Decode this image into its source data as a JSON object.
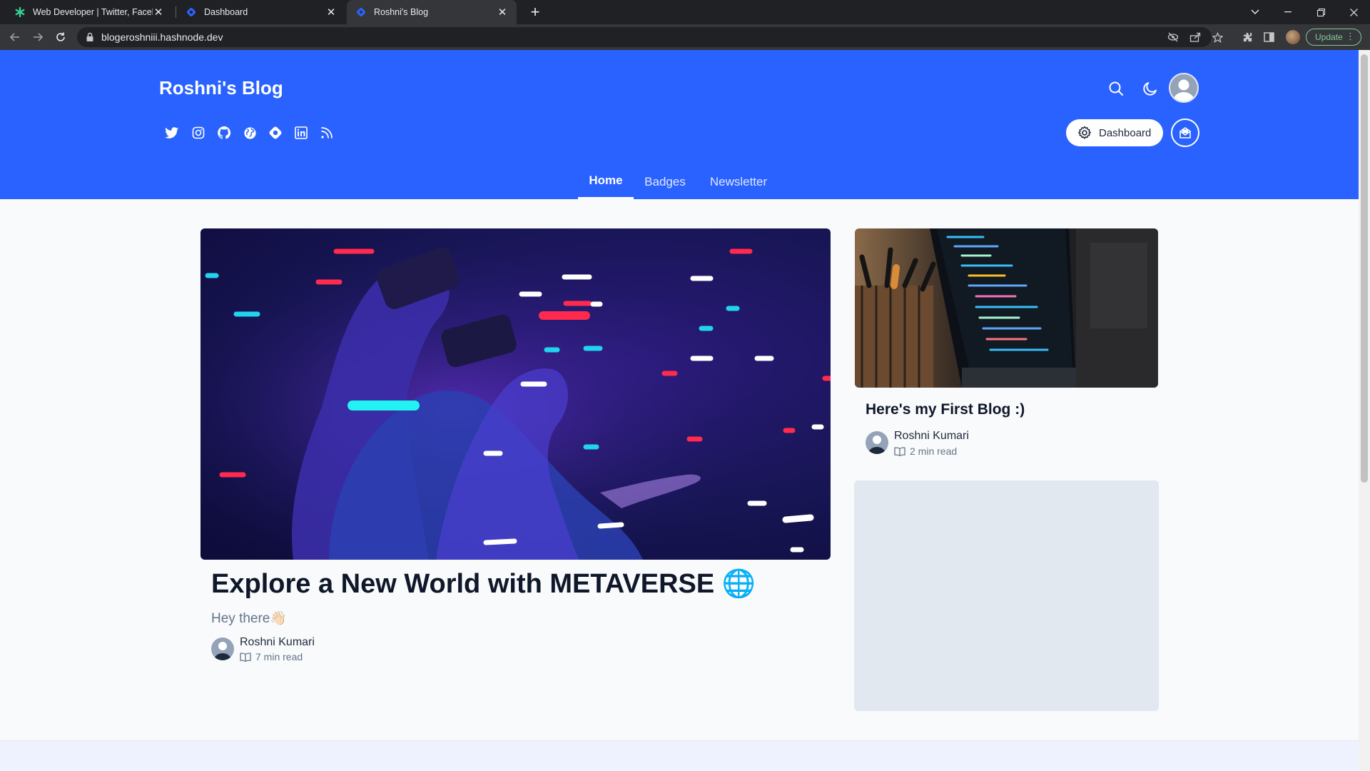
{
  "browser": {
    "tabs": [
      {
        "title": "Web Developer | Twitter, Faceboo",
        "icon": "asterisk-green-icon",
        "active": false
      },
      {
        "title": "Dashboard",
        "icon": "hashnode-icon",
        "active": false
      },
      {
        "title": "Roshni's Blog",
        "icon": "hashnode-icon",
        "active": true
      }
    ],
    "new_tab_label": "+",
    "url": "blogeroshniii.hashnode.dev",
    "update_label": "Update",
    "colors": {
      "tabbar": "#202124",
      "toolbar": "#35363a",
      "update_green": "#81c995"
    }
  },
  "header": {
    "blog_title": "Roshni's Blog",
    "social_icons": [
      "twitter-icon",
      "instagram-icon",
      "github-icon",
      "globe-icon",
      "hashnode-icon",
      "linkedin-icon",
      "rss-icon"
    ],
    "dashboard_label": "Dashboard",
    "nav": [
      {
        "label": "Home",
        "active": true
      },
      {
        "label": "Badges",
        "active": false
      },
      {
        "label": "Newsletter",
        "active": false
      }
    ],
    "colors": {
      "brand_blue": "#2962ff"
    }
  },
  "featured_post": {
    "title": "Explore a New World with METAVERSE 🌐",
    "subtitle": "Hey there👋🏻",
    "author": "Roshni Kumari",
    "read_time": "7 min read"
  },
  "side_post": {
    "title": "Here's my First Blog :)",
    "author": "Roshni Kumari",
    "read_time": "2 min read"
  }
}
